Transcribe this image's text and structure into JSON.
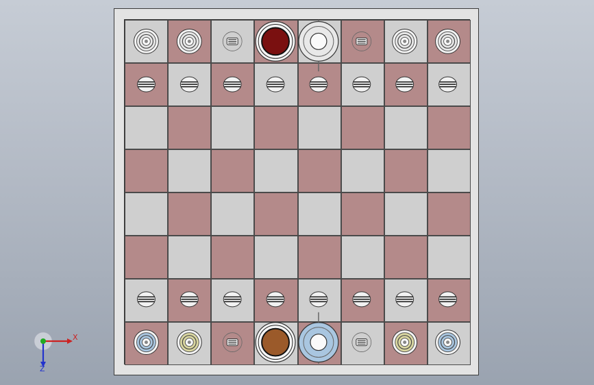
{
  "viewport": {
    "background_top": "#c6ccd5",
    "background_bottom": "#9aa3b0"
  },
  "board": {
    "rows": 8,
    "cols": 8,
    "light_color": "#cfcfcf",
    "dark_color": "#b48a8a",
    "top_left_is_light": true
  },
  "pieces": [
    {
      "row": 0,
      "col": 0,
      "type": "rook",
      "side": "dark"
    },
    {
      "row": 0,
      "col": 1,
      "type": "knight",
      "side": "dark"
    },
    {
      "row": 0,
      "col": 2,
      "type": "bishop",
      "side": "dark"
    },
    {
      "row": 0,
      "col": 3,
      "type": "queen",
      "side": "dark"
    },
    {
      "row": 0,
      "col": 4,
      "type": "king",
      "side": "dark"
    },
    {
      "row": 0,
      "col": 5,
      "type": "bishop",
      "side": "dark"
    },
    {
      "row": 0,
      "col": 6,
      "type": "knight",
      "side": "dark"
    },
    {
      "row": 0,
      "col": 7,
      "type": "rook",
      "side": "dark"
    },
    {
      "row": 1,
      "col": 0,
      "type": "pawn",
      "side": "dark"
    },
    {
      "row": 1,
      "col": 1,
      "type": "pawn",
      "side": "dark"
    },
    {
      "row": 1,
      "col": 2,
      "type": "pawn",
      "side": "dark"
    },
    {
      "row": 1,
      "col": 3,
      "type": "pawn",
      "side": "dark"
    },
    {
      "row": 1,
      "col": 4,
      "type": "pawn",
      "side": "dark"
    },
    {
      "row": 1,
      "col": 5,
      "type": "pawn",
      "side": "dark"
    },
    {
      "row": 1,
      "col": 6,
      "type": "pawn",
      "side": "dark"
    },
    {
      "row": 1,
      "col": 7,
      "type": "pawn",
      "side": "dark"
    },
    {
      "row": 6,
      "col": 0,
      "type": "pawn",
      "side": "light"
    },
    {
      "row": 6,
      "col": 1,
      "type": "pawn",
      "side": "light"
    },
    {
      "row": 6,
      "col": 2,
      "type": "pawn",
      "side": "light"
    },
    {
      "row": 6,
      "col": 3,
      "type": "pawn",
      "side": "light"
    },
    {
      "row": 6,
      "col": 4,
      "type": "pawn",
      "side": "light"
    },
    {
      "row": 6,
      "col": 5,
      "type": "pawn",
      "side": "light"
    },
    {
      "row": 6,
      "col": 6,
      "type": "pawn",
      "side": "light"
    },
    {
      "row": 6,
      "col": 7,
      "type": "pawn",
      "side": "light"
    },
    {
      "row": 7,
      "col": 0,
      "type": "rook",
      "side": "light",
      "tint": "#a9c6e0"
    },
    {
      "row": 7,
      "col": 1,
      "type": "knight",
      "side": "light",
      "tint": "#d9d6a0"
    },
    {
      "row": 7,
      "col": 2,
      "type": "bishop",
      "side": "light"
    },
    {
      "row": 7,
      "col": 3,
      "type": "queen",
      "side": "light",
      "tint": "#9b5a2a"
    },
    {
      "row": 7,
      "col": 4,
      "type": "king",
      "side": "light",
      "tint": "#a9c6e0"
    },
    {
      "row": 7,
      "col": 5,
      "type": "bishop",
      "side": "light"
    },
    {
      "row": 7,
      "col": 6,
      "type": "knight",
      "side": "light",
      "tint": "#d9d6a0"
    },
    {
      "row": 7,
      "col": 7,
      "type": "rook",
      "side": "light",
      "tint": "#a9c6e0"
    }
  ],
  "piece_colors": {
    "dark_queen": "#7a1010",
    "metal": "#e8e8e8",
    "outline": "#333333"
  },
  "triad": {
    "x_label": "X",
    "z_label": "Z",
    "x_color": "#cc2222",
    "y_color": "#22aa22",
    "z_color": "#2233cc"
  }
}
